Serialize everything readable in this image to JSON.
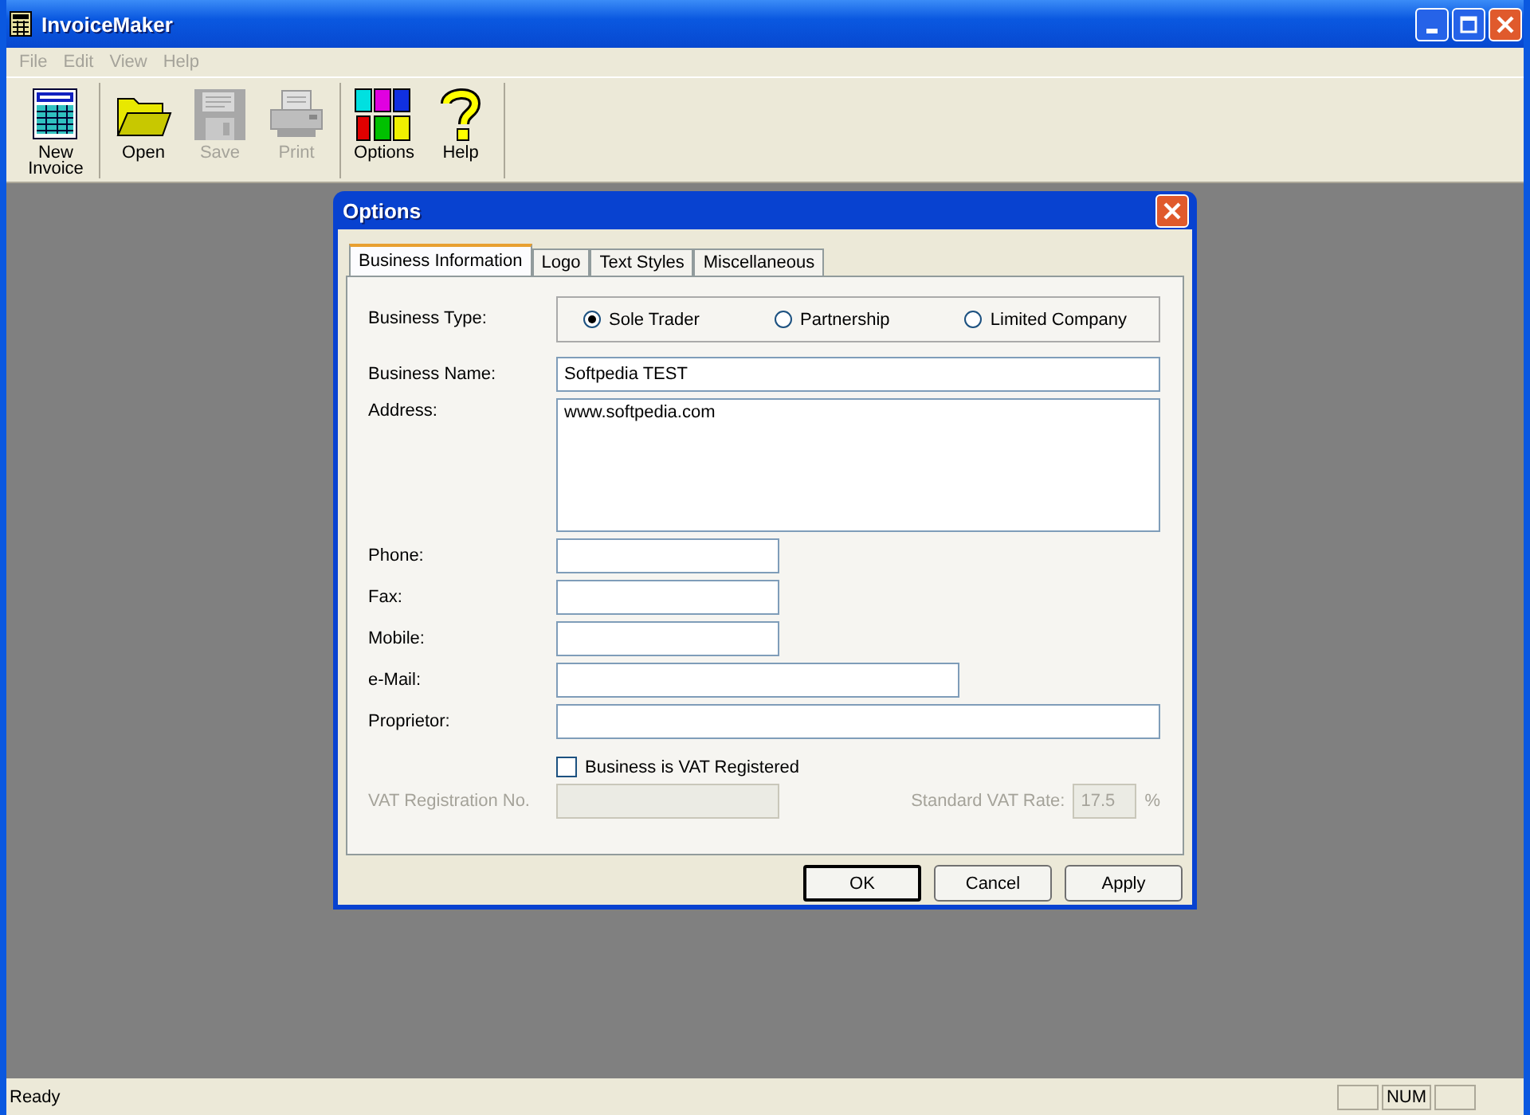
{
  "window": {
    "title": "InvoiceMaker"
  },
  "menu": [
    {
      "label": "File",
      "disabled": true
    },
    {
      "label": "Edit",
      "disabled": true
    },
    {
      "label": "View",
      "disabled": true
    },
    {
      "label": "Help",
      "disabled": true
    }
  ],
  "toolbar": {
    "groups": [
      [
        {
          "label": "New Invoice",
          "kind": "invoice",
          "disabled": false
        }
      ],
      [
        {
          "label": "Open",
          "kind": "folder",
          "disabled": false
        },
        {
          "label": "Save",
          "kind": "disk",
          "disabled": true
        },
        {
          "label": "Print",
          "kind": "printer",
          "disabled": true
        }
      ],
      [
        {
          "label": "Options",
          "kind": "blocks",
          "disabled": false
        },
        {
          "label": "Help",
          "kind": "question",
          "disabled": false
        }
      ]
    ]
  },
  "dialog": {
    "title": "Options",
    "tabs": [
      {
        "label": "Business Information",
        "selected": true
      },
      {
        "label": "Logo",
        "selected": false
      },
      {
        "label": "Text Styles",
        "selected": false
      },
      {
        "label": "Miscellaneous",
        "selected": false
      }
    ],
    "business_type": {
      "label": "Business Type:",
      "options": [
        {
          "label": "Sole Trader",
          "selected": true
        },
        {
          "label": "Partnership",
          "selected": false
        },
        {
          "label": "Limited Company",
          "selected": false
        }
      ]
    },
    "fields": [
      {
        "label": "Business Name:",
        "value": "Softpedia TEST",
        "kind": "long"
      },
      {
        "label": "Address:",
        "value": "www.softpedia.com",
        "kind": "multiline"
      },
      {
        "label": "Phone:",
        "kind": "short"
      },
      {
        "label": "Fax:",
        "kind": "short"
      },
      {
        "label": "Mobile:",
        "kind": "short"
      },
      {
        "label": "e-Mail:",
        "kind": "medium"
      },
      {
        "label": "Proprietor:",
        "kind": "long"
      }
    ],
    "vat_checkbox": {
      "label": "Business is VAT Registered",
      "checked": false
    },
    "vat_registration": {
      "label": "VAT Registration No.",
      "disabled": true
    },
    "vat_rate": {
      "label": "Standard VAT Rate:",
      "value": "17.5",
      "unit": "%",
      "disabled": true
    },
    "buttons": [
      {
        "label": "OK",
        "default": true
      },
      {
        "label": "Cancel",
        "default": false
      },
      {
        "label": "Apply",
        "default": false
      }
    ]
  },
  "status_bar": {
    "text": "Ready",
    "panels": [
      "NUM"
    ]
  }
}
